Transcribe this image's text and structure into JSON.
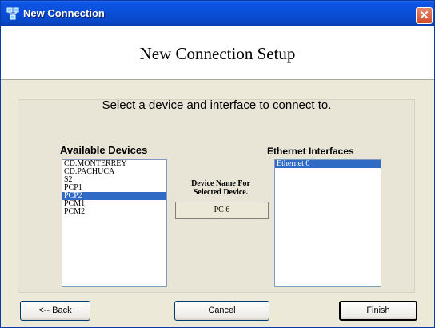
{
  "window": {
    "title": "New Connection",
    "close_glyph": "✕"
  },
  "header": {
    "title": "New Connection Setup"
  },
  "instruction": "Select a device and interface to connect to.",
  "devices": {
    "label": "Available Devices",
    "items": [
      "CD.MONTERREY",
      "CD.PACHUCA",
      "S2",
      "PCP1",
      "PCP2",
      "PCM1",
      "PCM2"
    ],
    "selected_index": 4
  },
  "selected_device": {
    "label_line1": "Device Name For",
    "label_line2": "Selected Device.",
    "value": "PC 6"
  },
  "interfaces": {
    "label": "Ethernet Interfaces",
    "items": [
      "Ethernet 0"
    ],
    "selected_index": 0
  },
  "buttons": {
    "back": "<-- Back",
    "cancel": "Cancel",
    "finish": "Finish"
  },
  "icons": {
    "app": "network-connection-icon",
    "close": "close-icon"
  },
  "colors": {
    "titlebar": "#0a4fd8",
    "selection": "#316ac5",
    "dialog_background": "#ece9d8",
    "close_button": "#d1492a"
  }
}
